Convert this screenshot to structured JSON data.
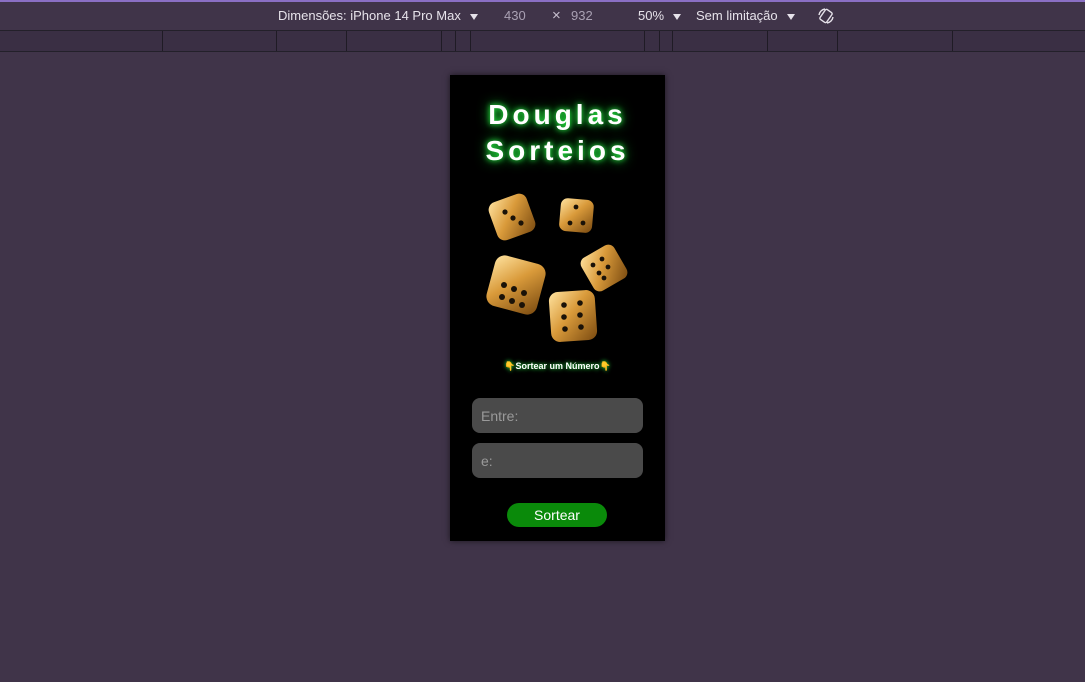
{
  "devtools": {
    "dimensions_label": "Dimensões: iPhone 14 Pro Max",
    "width": "430",
    "times": "×",
    "height": "932",
    "zoom": "50%",
    "throttle": "Sem limitação",
    "rotate_icon": "rotate-icon"
  },
  "app": {
    "title_line1": "Douglas",
    "title_line2": "Sorteios",
    "subtitle": "👇Sortear um Número👇",
    "inputs": [
      {
        "placeholder": "Entre:"
      },
      {
        "placeholder": "e:"
      }
    ],
    "button_label": "Sortear",
    "colors": {
      "accent_glow": "#2bff4a",
      "button": "#0a8a0a",
      "background": "#000000"
    }
  }
}
